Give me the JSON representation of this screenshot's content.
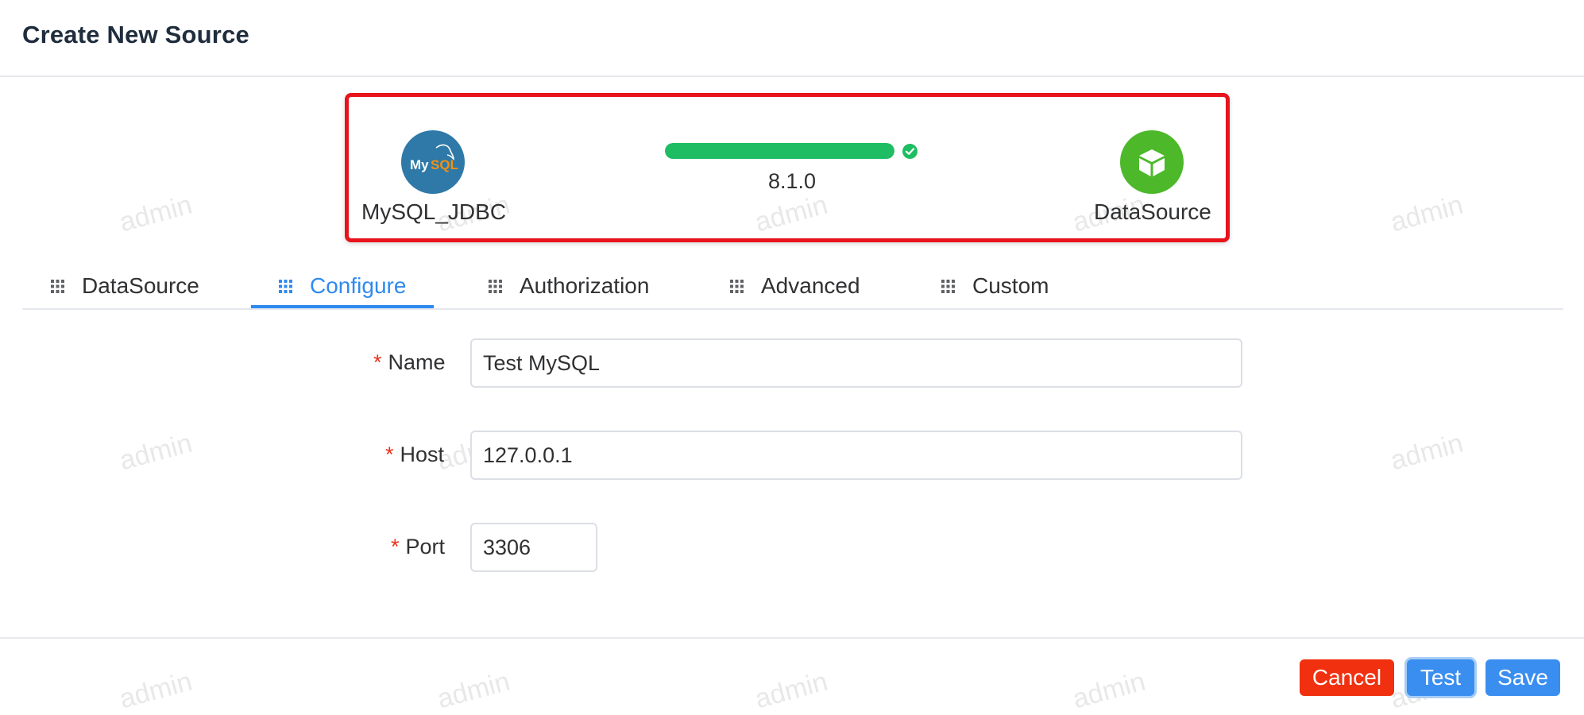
{
  "dialog": {
    "title": "Create New Source"
  },
  "flow": {
    "source": {
      "label": "MySQL_JDBC",
      "logo_text": "MySQL",
      "icon": "mysql-logo-icon",
      "color": "#2e79a8"
    },
    "connector": {
      "version": "8.1.0",
      "progress_percent": 100,
      "status_icon": "check-circle-icon",
      "color": "#1ebd63"
    },
    "target": {
      "label": "DataSource",
      "icon": "cube-icon",
      "color": "#4cb82a"
    },
    "highlight_color": "#e8131b"
  },
  "tabs": [
    {
      "label": "DataSource",
      "icon": "grid-icon"
    },
    {
      "label": "Configure",
      "icon": "grid-icon",
      "active": true
    },
    {
      "label": "Authorization",
      "icon": "grid-icon"
    },
    {
      "label": "Advanced",
      "icon": "grid-icon"
    },
    {
      "label": "Custom",
      "icon": "grid-icon"
    }
  ],
  "form": {
    "required_marker": "*",
    "name": {
      "label": "Name",
      "value": "Test MySQL"
    },
    "host": {
      "label": "Host",
      "value": "127.0.0.1"
    },
    "port": {
      "label": "Port",
      "value": "3306"
    }
  },
  "buttons": {
    "cancel": "Cancel",
    "test": "Test",
    "save": "Save"
  },
  "watermark": "admin",
  "colors": {
    "accent": "#2f8af0",
    "danger": "#f0300f",
    "required": "#e8331b"
  }
}
